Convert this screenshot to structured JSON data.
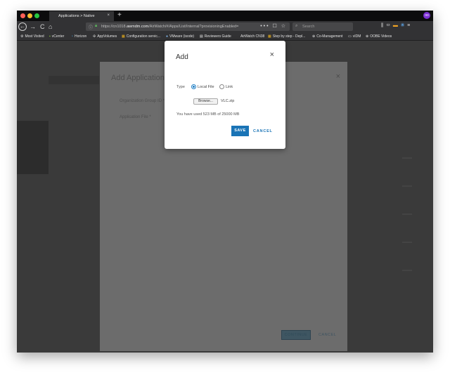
{
  "tabbar": {
    "tab_title": "Applications > Native",
    "tab_close": "×",
    "new_tab": "+"
  },
  "navbar": {
    "back": "←",
    "forward": "→",
    "reload": "C",
    "home": "⌂",
    "url_prefix": "https://cn1018.",
    "url_domain": "awmdm.com",
    "url_suffix": "/AirWatch/#/Apps/List/Internal?provisioningEnabled=",
    "url_actions": "••• ☐ ☆",
    "search_placeholder": "Search"
  },
  "bookmarks": [
    {
      "icon": "⚙",
      "label": "Most Visited"
    },
    {
      "icon": "▪",
      "label": "vCenter"
    },
    {
      "icon": "◔",
      "label": "Horizon"
    },
    {
      "icon": "✣",
      "label": "AppVolumes"
    },
    {
      "icon": "▦",
      "label": "Configuration servic..."
    },
    {
      "icon": "●",
      "label": "VMware (isode)"
    },
    {
      "icon": "▤",
      "label": "Reviewers Guide"
    },
    {
      "icon": "",
      "label": "AirWatch CN38"
    },
    {
      "icon": "▦",
      "label": "Step by step - Depl..."
    },
    {
      "icon": "⊕",
      "label": "Co-Management"
    },
    {
      "icon": "▭",
      "label": "vIDM"
    },
    {
      "icon": "⊕",
      "label": "OOBE Videos"
    }
  ],
  "under_modal": {
    "title": "Add Application",
    "close": "×",
    "org_group_label": "Organization Group ID *",
    "app_file_label": "Application File *",
    "continue_label": "CONTINUE",
    "cancel_label": "CANCEL"
  },
  "add_modal": {
    "title": "Add",
    "close": "×",
    "type_label": "Type",
    "option_local": "Local File",
    "option_link": "Link",
    "selected": "Local File",
    "browse_label": "Browse...",
    "file_name": "VLC.zip",
    "usage_text": "You have used 523 MB of 25000 MB",
    "save_label": "SAVE",
    "cancel_label": "CANCEL"
  },
  "colors": {
    "accent": "#1a74b6",
    "browser_chrome": "#323234",
    "overlay": "#3a3a3a"
  }
}
